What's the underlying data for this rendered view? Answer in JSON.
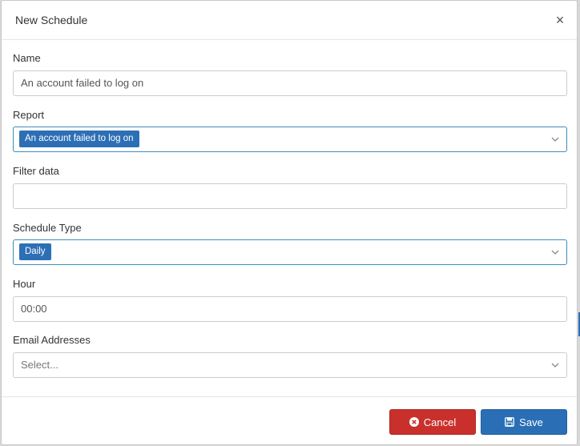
{
  "modal": {
    "title": "New Schedule",
    "close_symbol": "×"
  },
  "form": {
    "name": {
      "label": "Name",
      "value": "An account failed to log on"
    },
    "report": {
      "label": "Report",
      "selected": "An account failed to log on"
    },
    "filter": {
      "label": "Filter data",
      "value": ""
    },
    "schedule_type": {
      "label": "Schedule Type",
      "selected": "Daily"
    },
    "hour": {
      "label": "Hour",
      "value": "00:00"
    },
    "email": {
      "label": "Email Addresses",
      "placeholder": "Select..."
    }
  },
  "footer": {
    "cancel_label": "Cancel",
    "save_label": "Save"
  },
  "colors": {
    "accent": "#2a6fb5",
    "danger": "#c9302c",
    "focus_border": "#3c8dbc"
  },
  "icons": {
    "close": "close-icon",
    "dropdown": "chevron-down-icon",
    "cancel": "cancel-circle-icon",
    "save": "floppy-disk-icon"
  }
}
